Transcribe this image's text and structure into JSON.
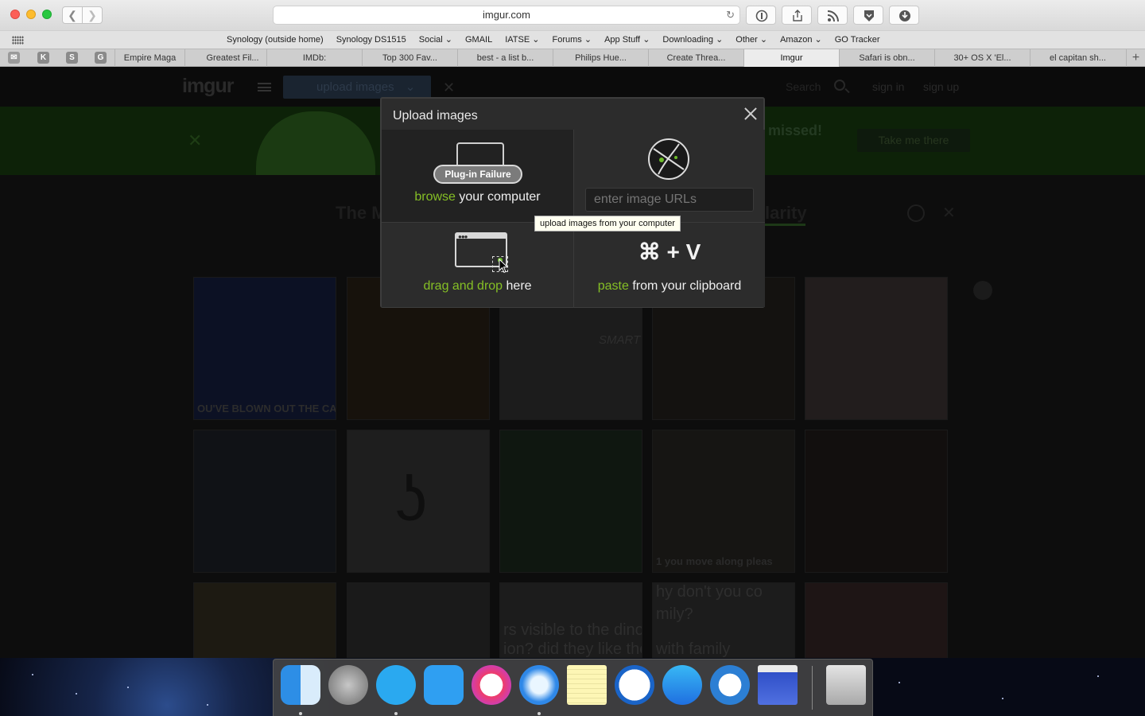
{
  "browser": {
    "url": "imgur.com",
    "favorites": [
      "Synology (outside home)",
      "Synology DS1515",
      "Social",
      "GMAIL",
      "IATSE",
      "Forums",
      "App Stuff",
      "Downloading",
      "Other",
      "Amazon",
      "GO Tracker"
    ],
    "pinned_tabs": [
      "K",
      "S",
      "G"
    ],
    "tabs": [
      "Empire Maga",
      "Greatest Fil...",
      "IMDb:",
      "Top 300 Fav...",
      "best - a list b...",
      "Philips Hue...",
      "Create Threa...",
      "Imgur",
      "Safari is obn...",
      "30+ OS X 'El...",
      "el capitan sh..."
    ],
    "active_tab": "Imgur"
  },
  "site": {
    "logo": "imgur",
    "upload_button": "upload images",
    "search_placeholder": "Search",
    "sign_in": "sign in",
    "sign_up": "sign up",
    "banner_text": "missed!",
    "banner_button": "Take me there",
    "headline_left": "The M",
    "headline_right": "larity"
  },
  "gallery": {
    "captions": [
      "OU'VE BLOWN OUT THE CANDLE",
      "SMART",
      "1 you move along pleas",
      "hy don't you co",
      "mily?",
      "with family",
      "rs visible to the dinos",
      "ion? did they like the"
    ]
  },
  "modal": {
    "title": "Upload images",
    "plugin_failure": "Plug-in Failure",
    "browse_green": "browse",
    "browse_rest": " your computer",
    "url_placeholder": "enter image URLs",
    "drag_green": "drag and drop",
    "drag_rest": " here",
    "paste_keys": "⌘ + V",
    "paste_green": "paste",
    "paste_rest": " from your clipboard",
    "tooltip": "upload images from your computer"
  },
  "dock": {
    "apps": [
      "finder",
      "launchpad",
      "messages",
      "tweetbot",
      "itunes",
      "safari",
      "notes",
      "1password",
      "app-store",
      "network-radar",
      "preview-window",
      "trash"
    ]
  },
  "colors": {
    "accent_green": "#85bf25",
    "modal_bg": "#2c2c2c",
    "page_bg": "#0d0d0d"
  }
}
